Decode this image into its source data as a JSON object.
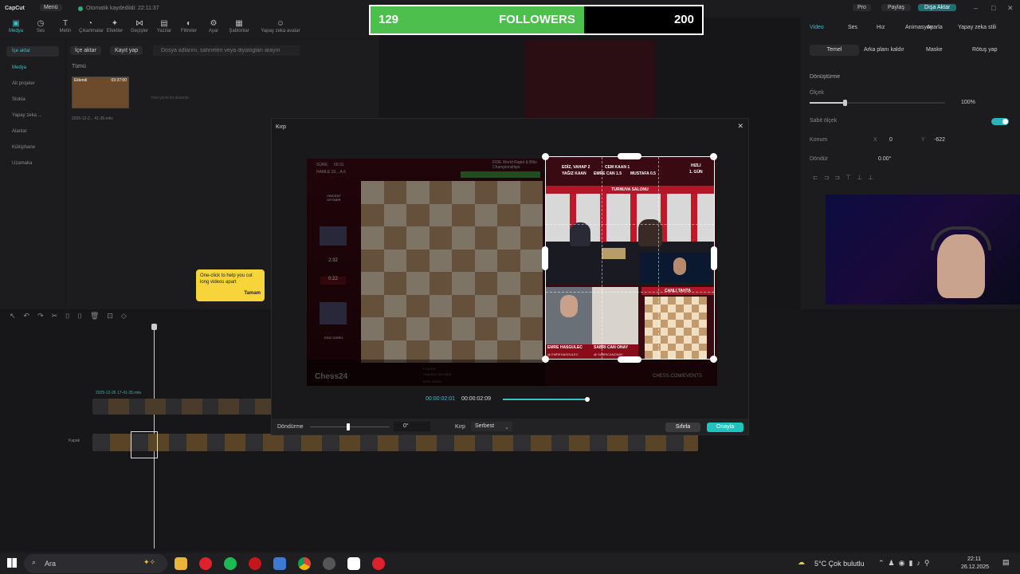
{
  "app": {
    "name": "CapCut",
    "menu": "Menü",
    "autosave": "Otomatik kaydedildi: 22:11:37",
    "pro": "Pro",
    "share": "Paylaş",
    "export": "Dışa Aktar"
  },
  "toolbar": [
    {
      "label": "Medya",
      "icon": "media-icon"
    },
    {
      "label": "Ses",
      "icon": "audio-icon"
    },
    {
      "label": "Metin",
      "icon": "text-icon"
    },
    {
      "label": "Çıkartmalar",
      "icon": "sticker-icon"
    },
    {
      "label": "Efektler",
      "icon": "effects-icon"
    },
    {
      "label": "Geçişler",
      "icon": "transitions-icon"
    },
    {
      "label": "Yazılar",
      "icon": "captions-icon"
    },
    {
      "label": "Filtreler",
      "icon": "filters-icon"
    },
    {
      "label": "Ayar",
      "icon": "adjust-icon"
    },
    {
      "label": "Şablonlar",
      "icon": "templates-icon"
    },
    {
      "label": "Yapay zeka avatar",
      "icon": "ai-avatar-icon"
    }
  ],
  "sidebar": {
    "items": [
      "İçe aktar",
      "Medya",
      "Alt projeler",
      "Stokla",
      "Yapay zeka ...",
      "Alanlar",
      "Kütüphane",
      "Uzamaka"
    ]
  },
  "media_panel": {
    "import_btn": "İçe aktar",
    "record_btn": "Kayıt yap",
    "search_placeholder": "Dosya adlarını, sahneleri veya diyalogları arayın",
    "filter_all": "Tümü",
    "clip_tag": "Eklendi",
    "clip_duration": "03:37:00",
    "clip_name": "2025-12-2... 41-35.mkv",
    "drop_hint": "Yeni çevril ile düzenle"
  },
  "followers": {
    "current": "129",
    "label": "FOLLOWERS",
    "target": "200",
    "fraction": 0.645
  },
  "right_panel": {
    "tabs": [
      "Video",
      "Ses",
      "Hız",
      "Animasyon",
      "Ayarla",
      "Yapay zeka stili"
    ],
    "subtabs": [
      "Temel",
      "Arka planı kaldır",
      "Maske",
      "Rötuş yap"
    ],
    "transform": "Dönüştürme",
    "scale": "Ölçek",
    "scale_value": "100%",
    "uniform_scale": "Sabit ölçek",
    "position": "Konum",
    "pos_x": "0",
    "pos_y": "-622",
    "rotate": "Döndür",
    "rotate_value": "0.00°",
    "x": "X",
    "y": "Y"
  },
  "crop_dialog": {
    "title": "Kırp",
    "time_current": "00:00:02:01",
    "time_total": "00:00:02:09",
    "rotate_label": "Döndürme",
    "rotate_value": "0°",
    "crop_label": "Kırp",
    "crop_value": "Serbest",
    "reset": "Sıfırla",
    "confirm": "Onayla",
    "playhead_fraction": 0.98
  },
  "video_overlay": {
    "timer_label": "SÜRE:",
    "timer": "00:31",
    "round": "HAMLE 33... A.6",
    "event": "FIDE World Rapid & Blitz Championships",
    "white_player": "VINCENT KEYMER",
    "black_player": "EDIZ GÜREL",
    "clock_white": "2:32",
    "clock_black": "0:22",
    "score_line1": "EDİZ, VAHAP 2",
    "score_line2": "CEM KAAN 1",
    "score_line3": "YAĞIZ KAAN",
    "score_line4": "EMRE CAN 1.5",
    "score_line5": "MUSTAFA 0.5",
    "mode": "HIZLI",
    "day": "1. GÜN",
    "hall": "TURNUVA SALONU",
    "live_board": "CANLI TAHTA",
    "cam1_name": "EMRE HASGULEC",
    "cam1_handle": "@ EMREHASGULEC",
    "cam2_name": "SABRI CAN ONAY",
    "cam2_handle": "@ SABRICANONAY",
    "brand": "Chess24",
    "site": "CHESS.COM/EVENTS",
    "table_header": "PLAYER"
  },
  "tooltip": {
    "text": "One-click to help you cut long videos apart",
    "button": "Tamam"
  },
  "timeline": {
    "cover_label": "Kapak",
    "track_label": "2025-12-26 17-41-35.mkv"
  },
  "taskbar": {
    "search": "Ara",
    "weather": "5°C  Çok bulutlu",
    "time": "22:11",
    "date": "26.12.2025"
  }
}
